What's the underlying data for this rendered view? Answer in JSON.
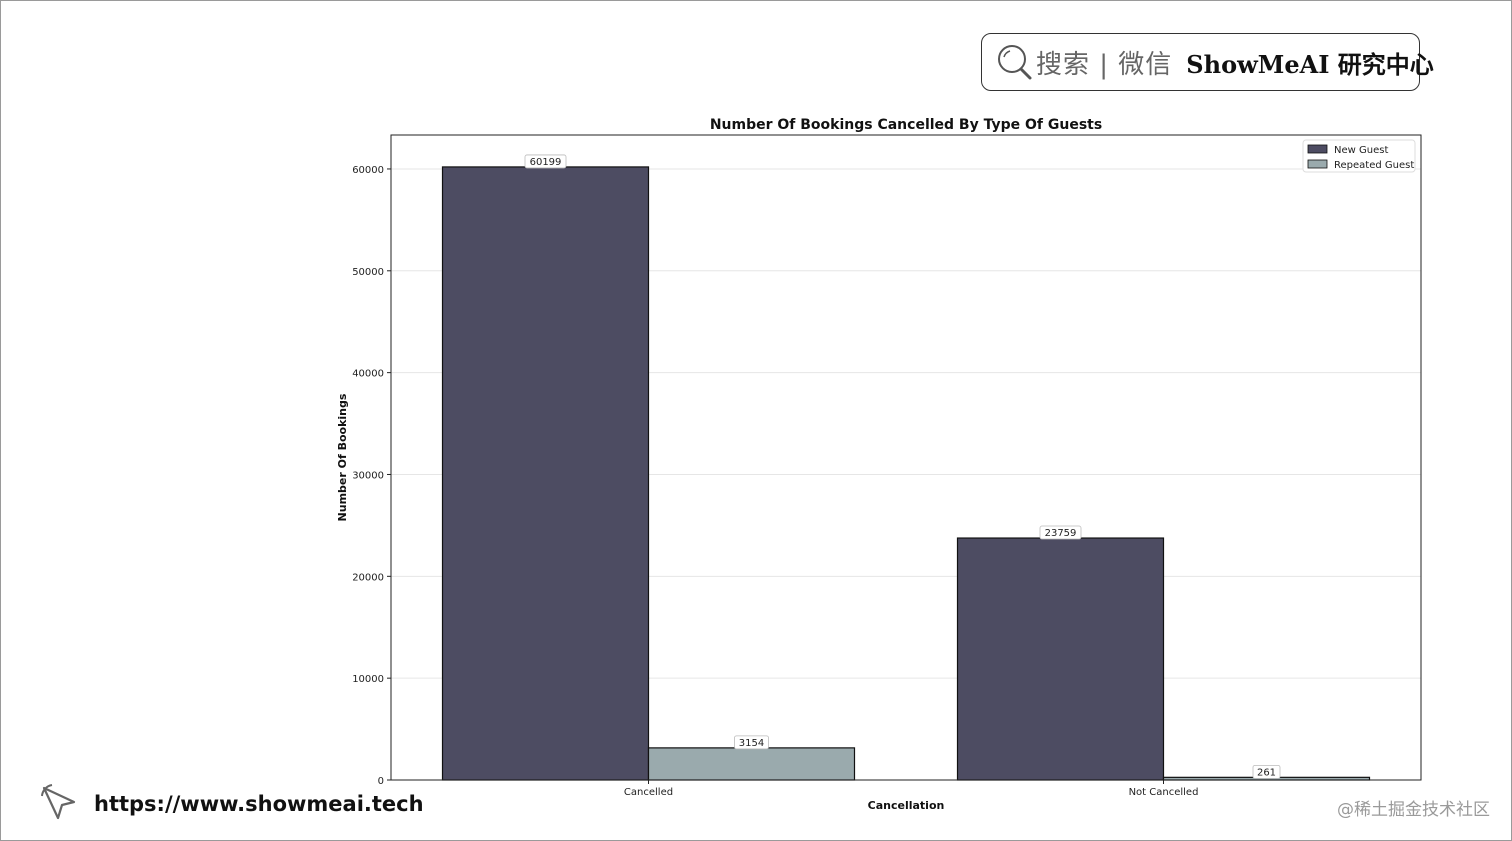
{
  "header": {
    "search_text": "搜索 | 微信",
    "brand_text": "ShowMeAI 研究中心"
  },
  "footer": {
    "url": "https://www.showmeai.tech",
    "watermark": "@稀土掘金技术社区"
  },
  "colors": {
    "new_guest": "#4d4c62",
    "repeated_guest": "#9aaaad",
    "grid": "#e6e6e6"
  },
  "chart_data": {
    "type": "bar",
    "title": "Number Of Bookings Cancelled By Type Of Guests",
    "xlabel": "Cancellation",
    "ylabel": "Number Of Bookings",
    "categories": [
      "Cancelled",
      "Not Cancelled"
    ],
    "series": [
      {
        "name": "New Guest",
        "values": [
          60199,
          23759
        ]
      },
      {
        "name": "Repeated Guest",
        "values": [
          3154,
          261
        ]
      }
    ],
    "ylim": [
      0,
      63334
    ],
    "yticks": [
      0,
      10000,
      20000,
      30000,
      40000,
      50000,
      60000
    ],
    "grid": true,
    "legend_position": "top-right"
  }
}
